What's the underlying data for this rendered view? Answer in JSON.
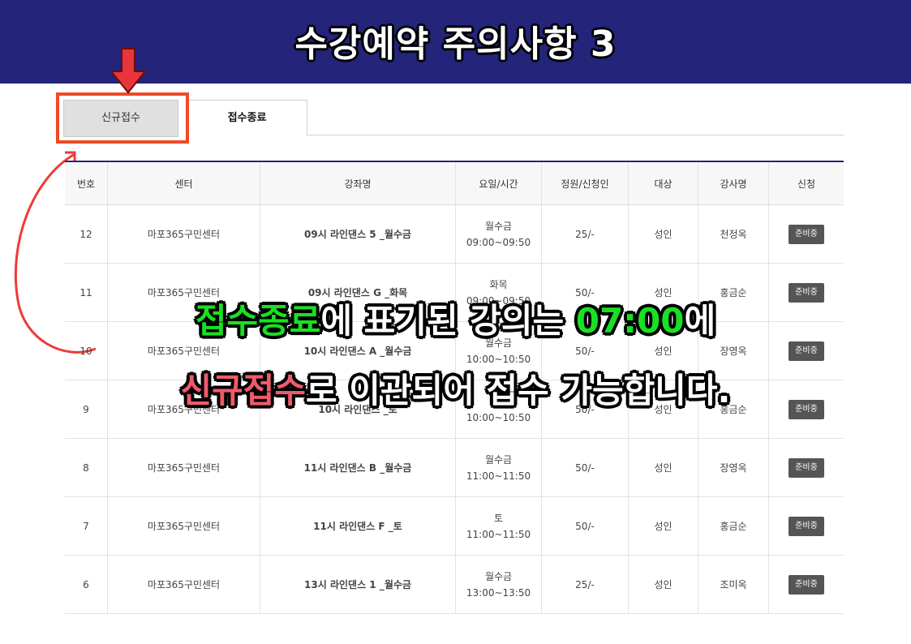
{
  "banner": {
    "title": "수강예약 주의사항 3"
  },
  "tabs": [
    {
      "label": "신규접수"
    },
    {
      "label": "접수종료"
    }
  ],
  "table": {
    "headers": [
      "번호",
      "센터",
      "강좌명",
      "요일/시간",
      "정원/신청인",
      "대상",
      "강사명",
      "신청"
    ],
    "rows": [
      {
        "no": "12",
        "center": "마포365구민센터",
        "course": "09시 라인댄스 5 _월수금",
        "day": "월수금",
        "time": "09:00~09:50",
        "capacity": "25/-",
        "target": "성인",
        "instructor": "천정옥",
        "status": "준비중"
      },
      {
        "no": "11",
        "center": "마포365구민센터",
        "course": "09시 라인댄스 G _화목",
        "day": "화목",
        "time": "09:00~09:50",
        "capacity": "50/-",
        "target": "성인",
        "instructor": "홍금순",
        "status": "준비중"
      },
      {
        "no": "10",
        "center": "마포365구민센터",
        "course": "10시 라인댄스 A _월수금",
        "day": "월수금",
        "time": "10:00~10:50",
        "capacity": "50/-",
        "target": "성인",
        "instructor": "장영옥",
        "status": "준비중"
      },
      {
        "no": "9",
        "center": "마포365구민센터",
        "course": "10시 라인댄스 _토",
        "day": "토",
        "time": "10:00~10:50",
        "capacity": "50/-",
        "target": "성인",
        "instructor": "홍금순",
        "status": "준비중"
      },
      {
        "no": "8",
        "center": "마포365구민센터",
        "course": "11시 라인댄스 B _월수금",
        "day": "월수금",
        "time": "11:00~11:50",
        "capacity": "50/-",
        "target": "성인",
        "instructor": "장영옥",
        "status": "준비중"
      },
      {
        "no": "7",
        "center": "마포365구민센터",
        "course": "11시 라인댄스 F _토",
        "day": "토",
        "time": "11:00~11:50",
        "capacity": "50/-",
        "target": "성인",
        "instructor": "홍금순",
        "status": "준비중"
      },
      {
        "no": "6",
        "center": "마포365구민센터",
        "course": "13시 라인댄스 1 _월수금",
        "day": "월수금",
        "time": "13:00~13:50",
        "capacity": "25/-",
        "target": "성인",
        "instructor": "조미옥",
        "status": "준비중"
      }
    ]
  },
  "overlay": {
    "line1_green": "접수종료",
    "line1_rest_a": "에 표기된 강의는 ",
    "line1_time": "07:00",
    "line1_rest_b": "에",
    "line2_pink": "신규접수",
    "line2_rest": "로 이관되어 접수 가능합니다."
  },
  "colors": {
    "banner": "#23247a",
    "highlight": "#f04a24",
    "green": "#19e022",
    "pink": "#ef5a6a"
  }
}
